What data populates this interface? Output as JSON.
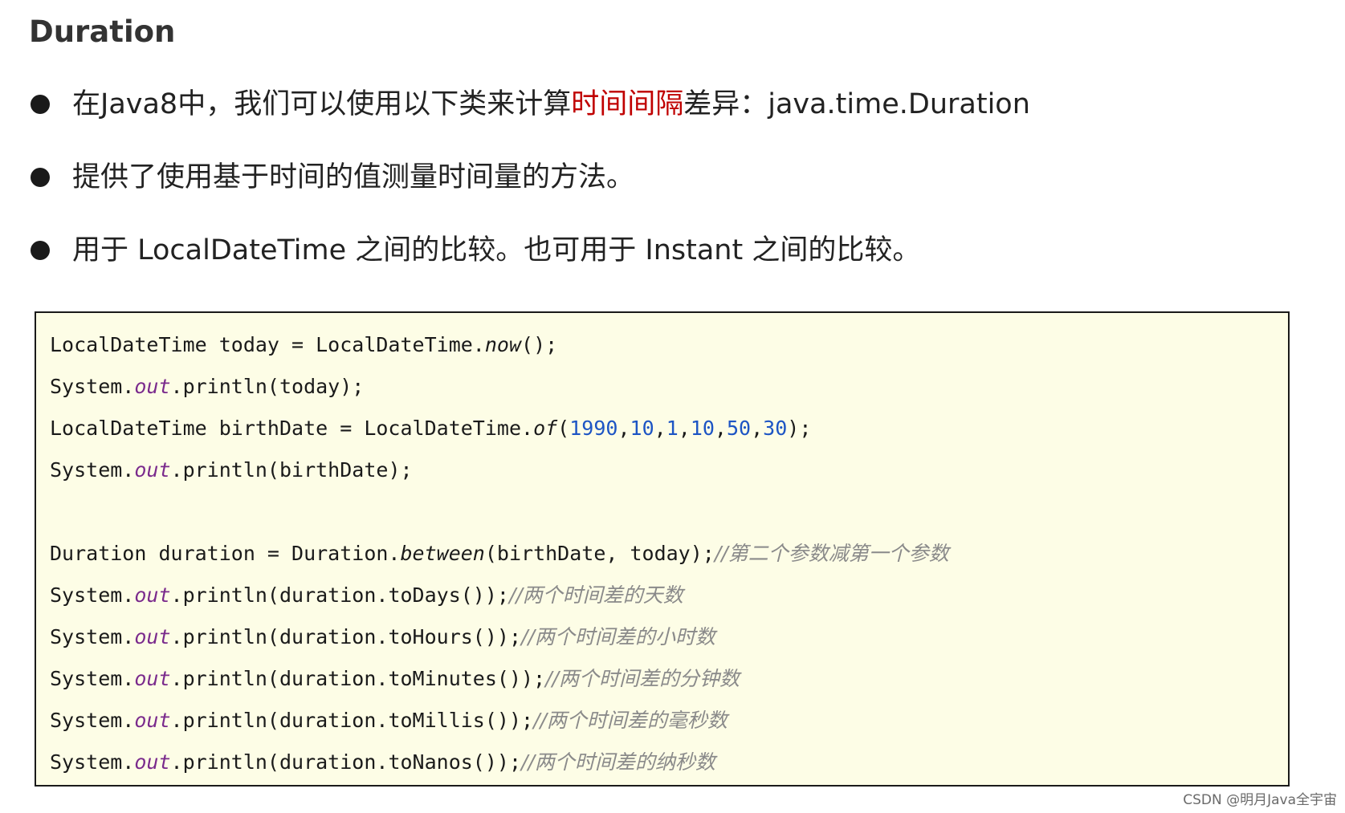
{
  "title": "Duration",
  "bullets": [
    {
      "before": "在Java8中，我们可以使用以下类来计算",
      "highlight": "时间间隔",
      "after": "差异：java.time.Duration"
    },
    {
      "before": "提供了使用基于时间的值测量时间量的方法。",
      "highlight": "",
      "after": ""
    },
    {
      "before": "用于 LocalDateTime 之间的比较。也可用于 Instant 之间的比较。",
      "highlight": "",
      "after": ""
    }
  ],
  "code": {
    "line1": {
      "a": "LocalDateTime today = LocalDateTime.",
      "m": "now",
      "b": "();"
    },
    "line2": {
      "a": "System.",
      "f": "out",
      "b": ".println(today);"
    },
    "line3": {
      "a": "LocalDateTime birthDate = LocalDateTime.",
      "m": "of",
      "open": "(",
      "n1": "1990",
      "n2": "10",
      "n3": "1",
      "n4": "10",
      "n5": "50",
      "n6": "30",
      "comma": ",",
      "close": ");"
    },
    "line4": {
      "a": "System.",
      "f": "out",
      "b": ".println(birthDate);"
    },
    "line6": {
      "a": "Duration duration = Duration.",
      "m": "between",
      "b": "(birthDate, today);",
      "c": "//第二个参数减第一个参数"
    },
    "line7": {
      "a": "System.",
      "f": "out",
      "b": ".println(duration.toDays());",
      "c": "//两个时间差的天数"
    },
    "line8": {
      "a": "System.",
      "f": "out",
      "b": ".println(duration.toHours());",
      "c": "//两个时间差的小时数"
    },
    "line9": {
      "a": "System.",
      "f": "out",
      "b": ".println(duration.toMinutes());",
      "c": "//两个时间差的分钟数"
    },
    "line10": {
      "a": "System.",
      "f": "out",
      "b": ".println(duration.toMillis());",
      "c": "//两个时间差的毫秒数"
    },
    "line11": {
      "a": "System.",
      "f": "out",
      "b": ".println(duration.toNanos());",
      "c": "//两个时间差的纳秒数"
    }
  },
  "watermark": "CSDN @明月Java全宇宙",
  "colors": {
    "highlight": "#c00000",
    "field": "#7a2a8c",
    "number": "#1d55c4",
    "comment": "#8a8a8a",
    "code_background": "#fdfde6"
  }
}
